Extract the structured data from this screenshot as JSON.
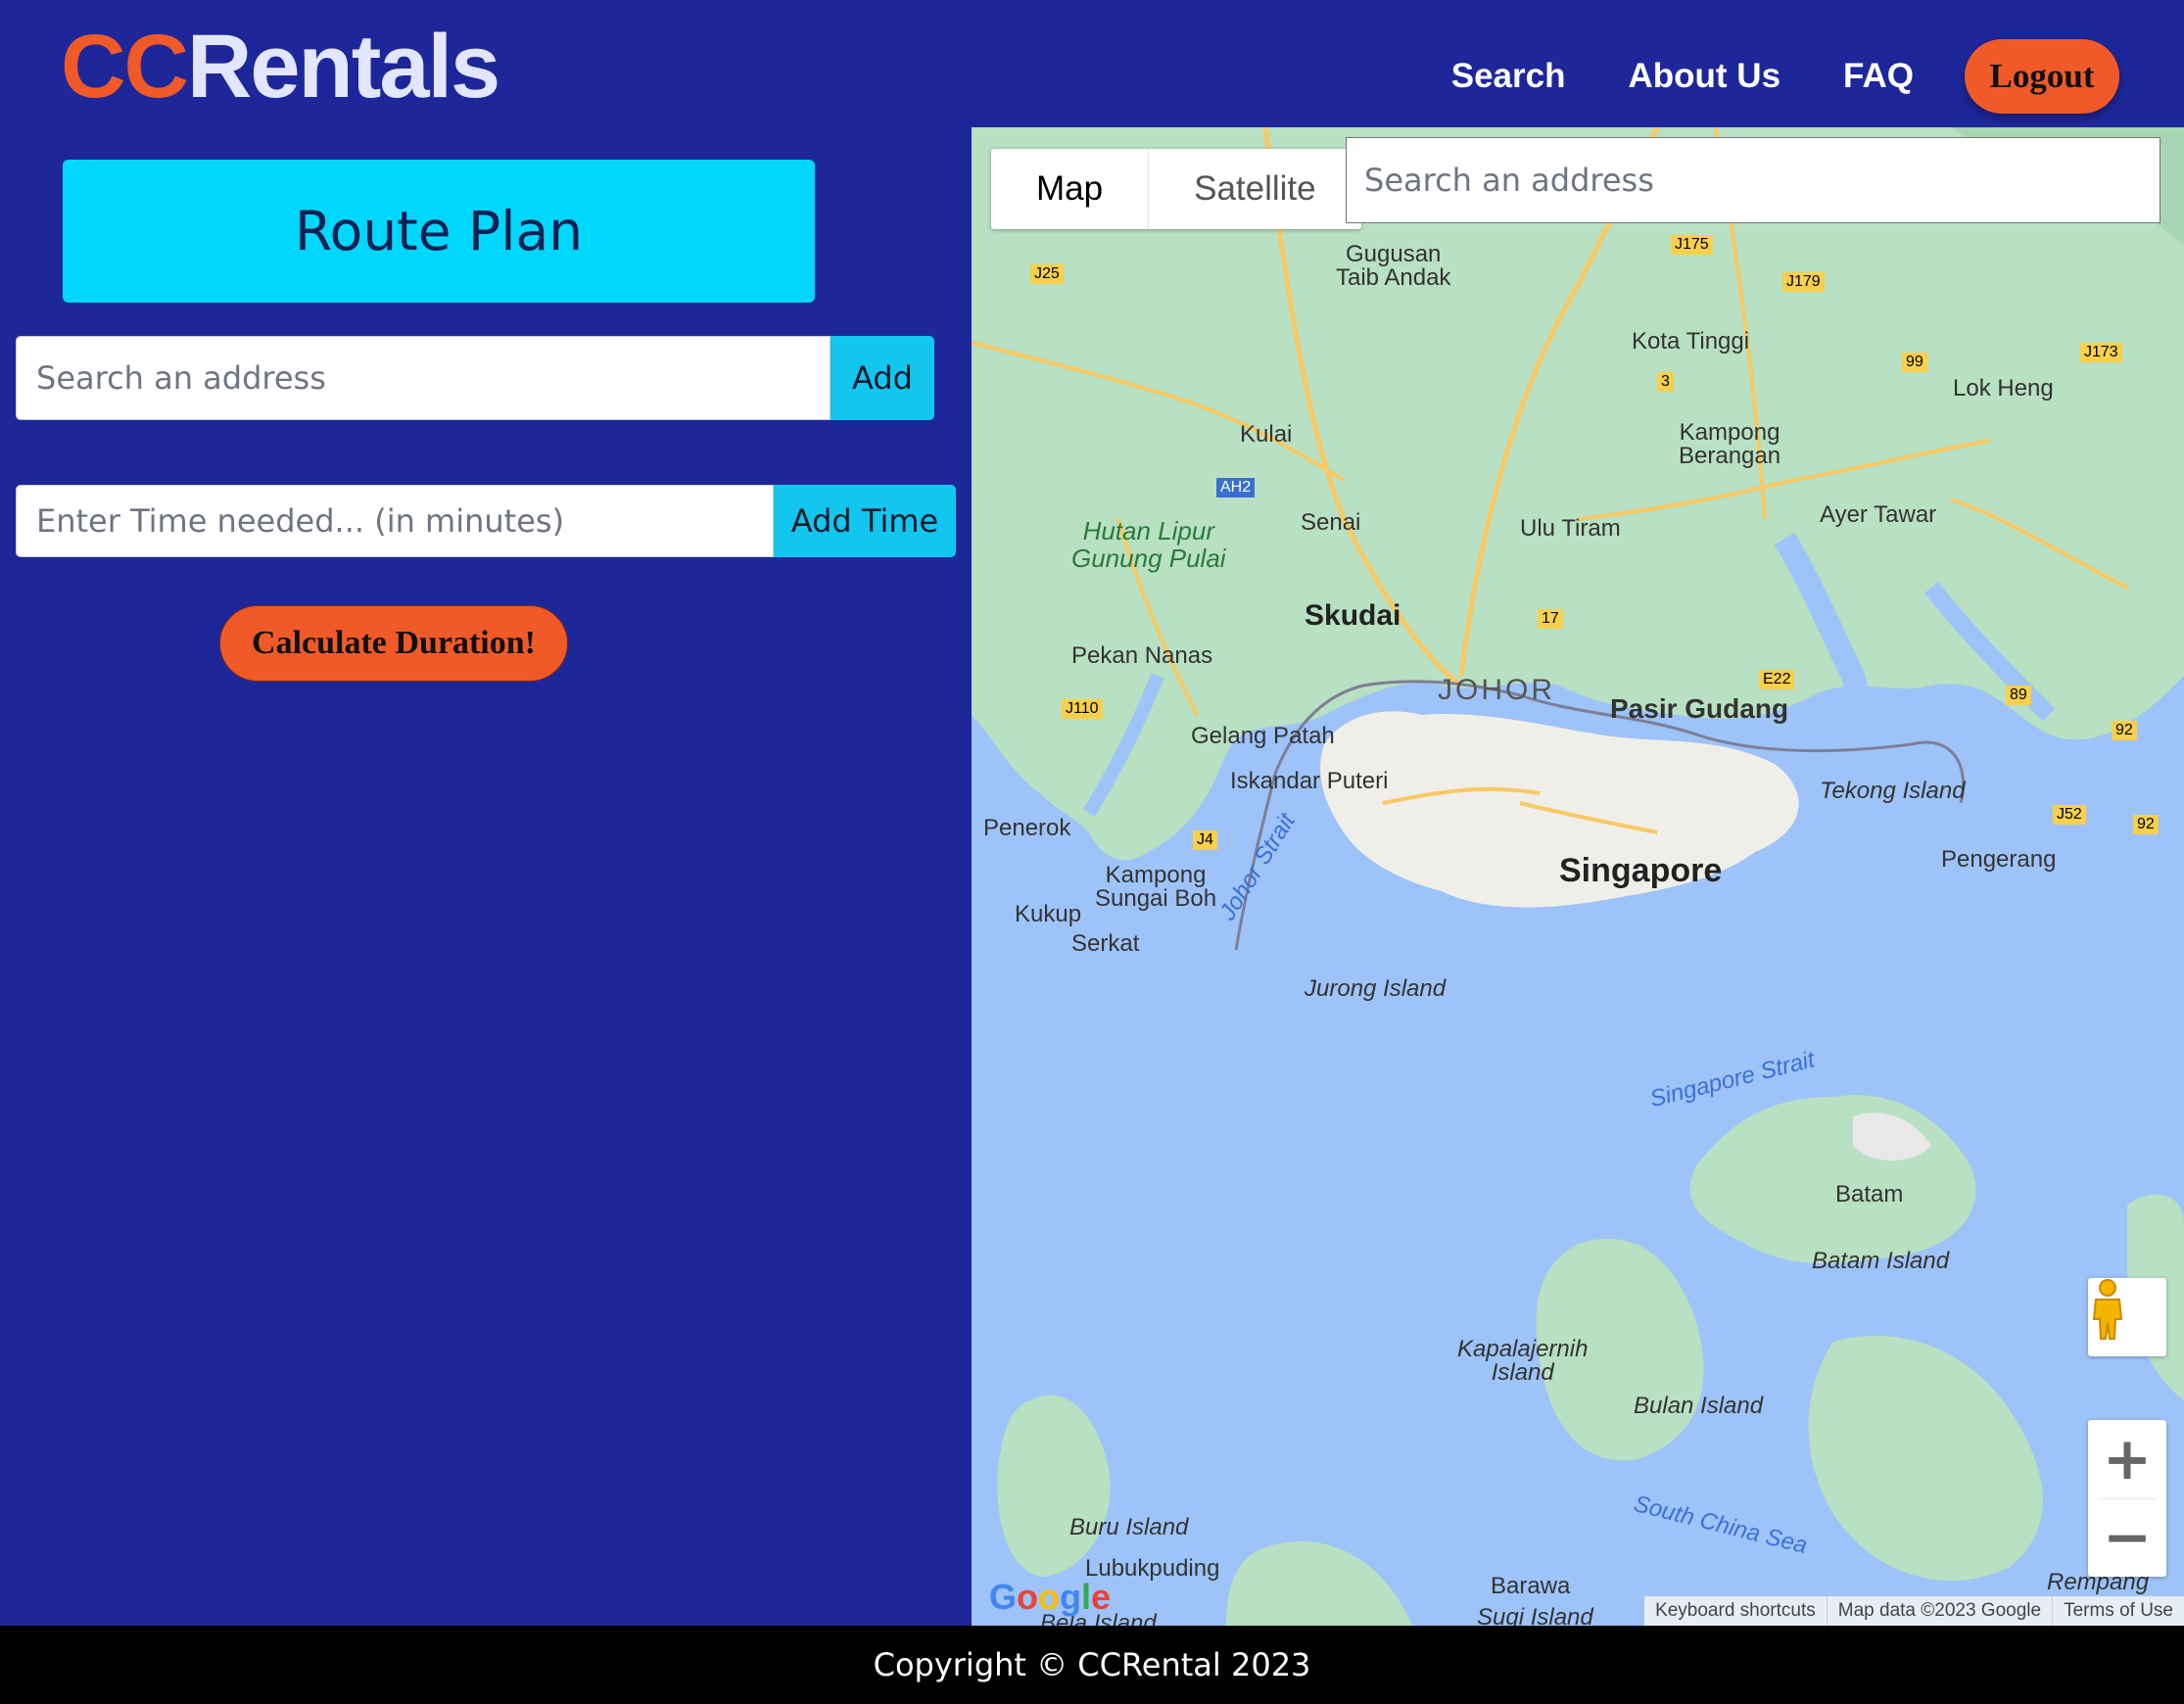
{
  "brand": {
    "part1": "CC",
    "part2": "Rentals"
  },
  "nav": {
    "items": [
      "Search",
      "About Us",
      "FAQ"
    ],
    "logout": "Logout"
  },
  "panel": {
    "title": "Route Plan",
    "address_placeholder": "Search an address",
    "add_label": "Add",
    "time_placeholder": "Enter Time needed... (in minutes)",
    "add_time_label": "Add Time",
    "calculate_label": "Calculate Duration!"
  },
  "map": {
    "type_map": "Map",
    "type_satellite": "Satellite",
    "search_placeholder": "Search an address",
    "labels": {
      "gugusan": "Gugusan\nTaib Andak",
      "kota_tinggi": "Kota Tinggi",
      "lok_heng": "Lok Heng",
      "kulai": "Kulai",
      "kampong_berangan": "Kampong\nBerangan",
      "senai": "Senai",
      "ulu_tiram": "Ulu Tiram",
      "ayer_tawar": "Ayer Tawar",
      "hutan": "Hutan Lipur\nGunung Pulai",
      "skudai": "Skudai",
      "pekan_nanas": "Pekan Nanas",
      "johor": "JOHOR",
      "pasir_gudang": "Pasir Gudang",
      "gelang_patah": "Gelang Patah",
      "iskandar": "Iskandar Puteri",
      "tekong": "Tekong Island",
      "penerok": "Penerok",
      "singapore": "Singapore",
      "pengerang": "Pengerang",
      "kampong_sungai": "Kampong\nSungai Boh",
      "kukup": "Kukup",
      "serkat": "Serkat",
      "johor_strait": "Johor Strait",
      "jurong": "Jurong Island",
      "singapore_strait": "Singapore Strait",
      "batam": "Batam",
      "batam_island": "Batam Island",
      "kapalajernih": "Kapalajernih\nIsland",
      "bulan": "Bulan Island",
      "south_china_sea": "South China Sea",
      "buru": "Buru Island",
      "lubukpuding": "Lubukpuding",
      "barawa": "Barawa",
      "rempang": "Rempang",
      "sugi": "Sugi Island",
      "belat": "Bela Island"
    },
    "shields": [
      "J25",
      "J175",
      "J179",
      "J173",
      "3",
      "99",
      "AH2",
      "17",
      "E22",
      "J110",
      "89",
      "92",
      "J4",
      "J52",
      "92"
    ],
    "attribution": [
      "Keyboard shortcuts",
      "Map data ©2023 Google",
      "Terms of Use"
    ],
    "google": "Google"
  },
  "footer": {
    "text": "Copyright © CCRental 2023"
  },
  "colors": {
    "header_bg": "#1e279a",
    "accent": "#f05a28",
    "cyan": "#00d7fb"
  }
}
